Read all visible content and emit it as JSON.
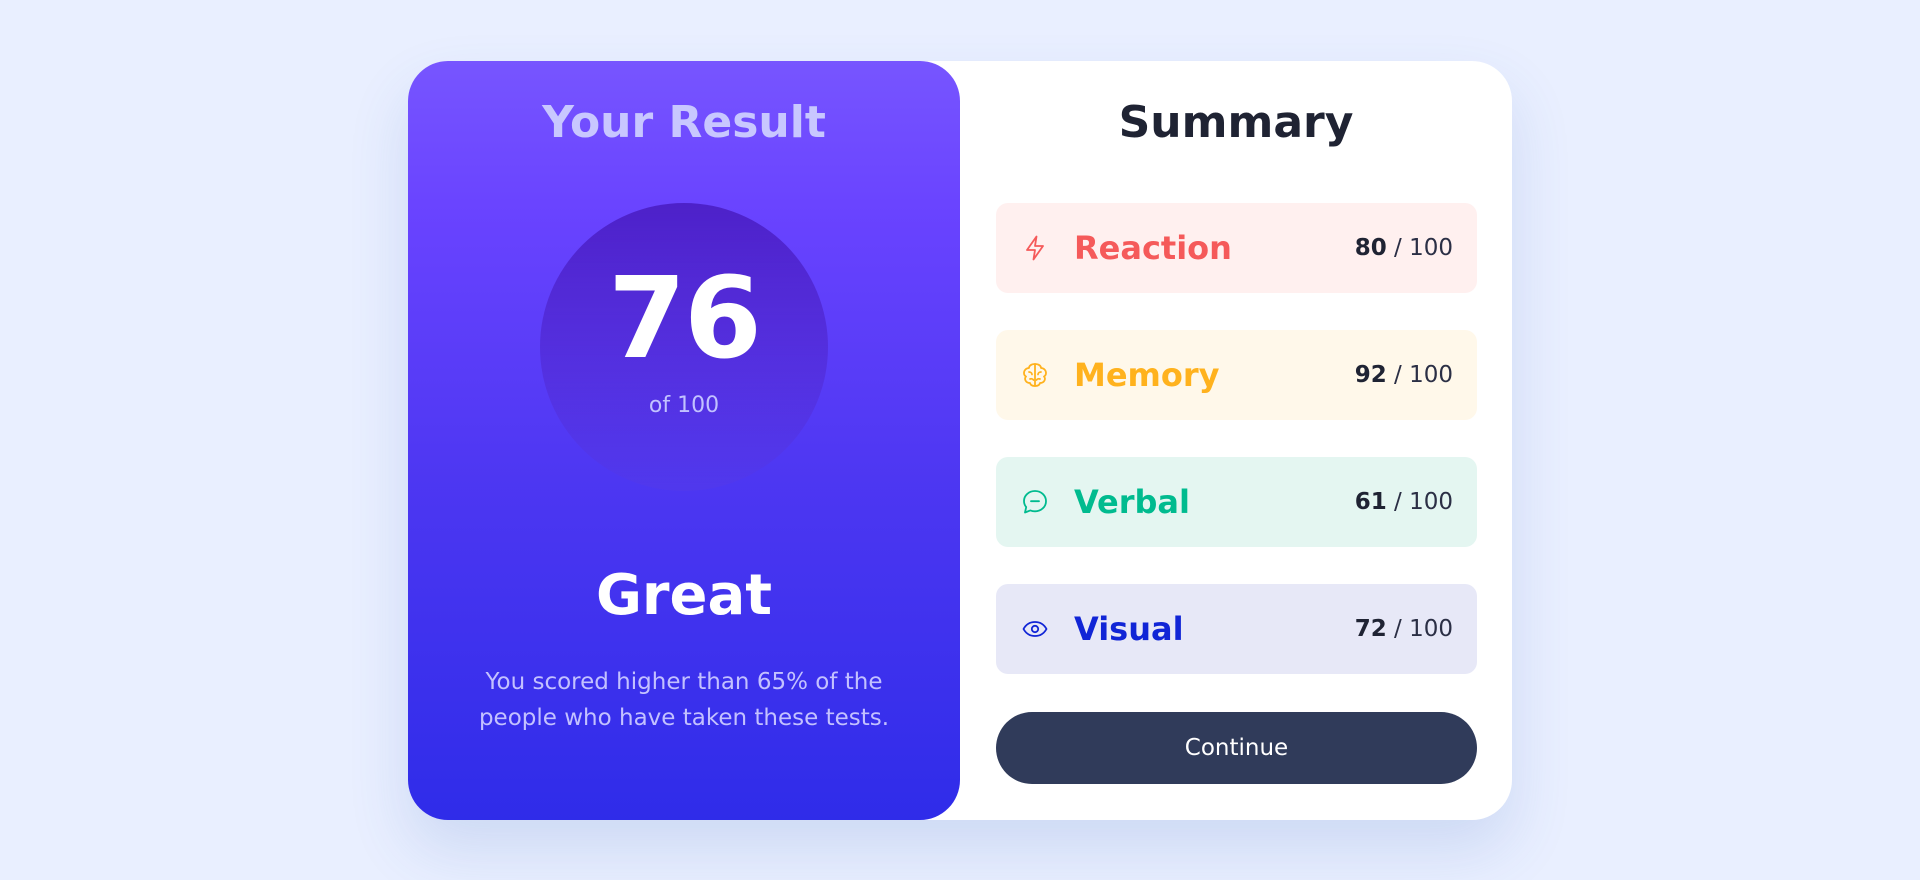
{
  "result": {
    "title": "Your Result",
    "score": "76",
    "score_of": "of 100",
    "grade": "Great",
    "description": "You scored higher than 65% of the people who have taken these tests."
  },
  "summary": {
    "title": "Summary",
    "items": [
      {
        "label": "Reaction",
        "score": "80",
        "total": "/ 100",
        "icon": "lightning-icon",
        "color": "#f55a5a",
        "bg": "#fff0ef"
      },
      {
        "label": "Memory",
        "score": "92",
        "total": "/ 100",
        "icon": "brain-icon",
        "color": "#ffb21e",
        "bg": "#fff8ea"
      },
      {
        "label": "Verbal",
        "score": "61",
        "total": "/ 100",
        "icon": "speech-bubble-icon",
        "color": "#00bb8f",
        "bg": "#e4f6f1"
      },
      {
        "label": "Visual",
        "score": "72",
        "total": "/ 100",
        "icon": "eye-icon",
        "color": "#1125d6",
        "bg": "#e7e8f7"
      }
    ],
    "continue_label": "Continue"
  }
}
